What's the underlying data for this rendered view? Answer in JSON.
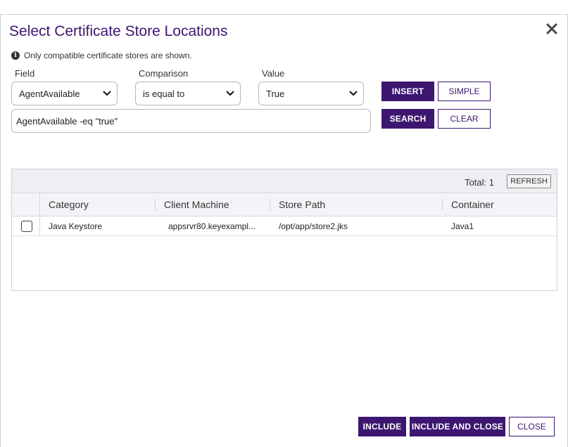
{
  "dialog": {
    "title": "Select Certificate Store Locations",
    "info": "Only compatible certificate stores are shown."
  },
  "filter": {
    "field_label": "Field",
    "field_value": "AgentAvailable",
    "comparison_label": "Comparison",
    "comparison_value": "is equal to",
    "value_label": "Value",
    "value_value": "True",
    "query": "AgentAvailable -eq \"true\"",
    "insert_label": "INSERT",
    "simple_label": "SIMPLE",
    "search_label": "SEARCH",
    "clear_label": "CLEAR"
  },
  "grid": {
    "total": "Total: 1",
    "refresh_label": "REFRESH",
    "columns": [
      "Category",
      "Client Machine",
      "Store Path",
      "Container"
    ],
    "rows": [
      {
        "category": "Java Keystore",
        "client_machine": "appsrvr80.keyexampl...",
        "store_path": "/opt/app/store2.jks",
        "container": "Java1",
        "checked": false
      }
    ]
  },
  "footer": {
    "include_label": "INCLUDE",
    "include_close_label": "INCLUDE AND CLOSE",
    "close_label": "CLOSE"
  },
  "colors": {
    "accent": "#3d1670",
    "grid_toolbar": "#eeeff3",
    "border": "#cfcfcf"
  },
  "icons": {
    "close": "close-icon",
    "info": "info-icon",
    "chevron": "chevron-down-icon"
  }
}
